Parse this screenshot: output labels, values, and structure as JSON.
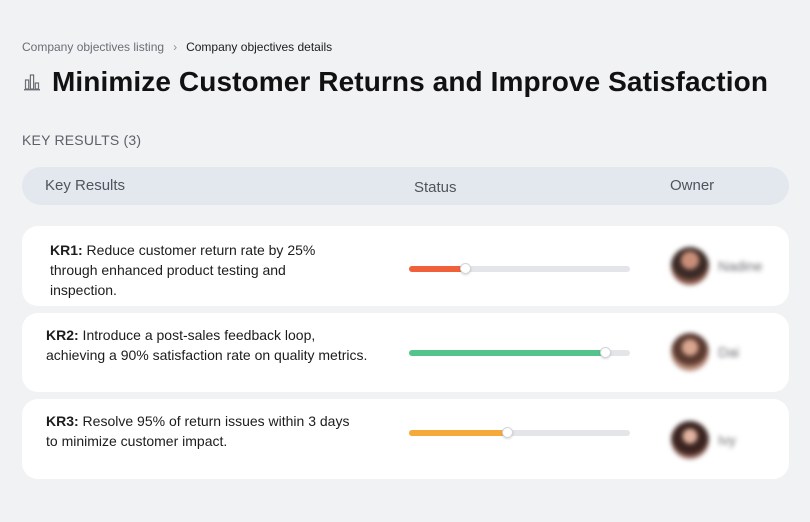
{
  "breadcrumb": {
    "parent": "Company objectives listing",
    "separator": "›",
    "current": "Company objectives details"
  },
  "objective": {
    "title": "Minimize Customer Returns and Improve Satisfaction",
    "icon": "building-chart-icon"
  },
  "key_results_section": {
    "label": "KEY RESULTS (3)"
  },
  "table": {
    "columns": [
      "Key Results",
      "Status",
      "Owner"
    ]
  },
  "key_results": [
    {
      "id": "KR1:",
      "line1": " Reduce customer return rate by 25%",
      "line2": "through enhanced product testing and",
      "line3": "inspection.",
      "progress": 0.26,
      "progress_color": "#f0603a",
      "owner": "Nadine"
    },
    {
      "id": "KR2:",
      "line1": " Introduce a post-sales feedback loop,",
      "line2": "achieving a 90% satisfaction rate on quality metrics.",
      "line3": "",
      "progress": 0.89,
      "progress_color": "#55c48b",
      "owner": "Dai"
    },
    {
      "id": "KR3:",
      "line1": " Resolve 95% of return issues within 3 days",
      "line2": "to minimize customer impact.",
      "line3": "",
      "progress": 0.45,
      "progress_color": "#f5a93a",
      "owner": "Ivy"
    }
  ]
}
